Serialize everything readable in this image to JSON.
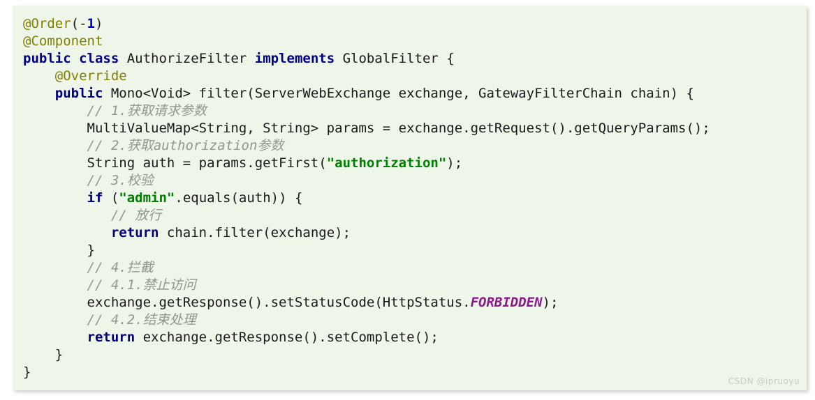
{
  "theme": {
    "page_background": "#ffffff",
    "code_background": "#eef5e9",
    "plain_color": "#1a1a1a",
    "annotation_color": "#808000",
    "keyword_color": "#000080",
    "string_color": "#008000",
    "number_color": "#0000c0",
    "comment_color": "#8f978f",
    "constant_color": "#8b1a8b"
  },
  "watermark": {
    "text": "CSDN @lpruoyu"
  },
  "code": {
    "language": "java",
    "lines": [
      {
        "indent": "",
        "tokens": [
          {
            "type": "annotation",
            "text": "@Order"
          },
          {
            "type": "plain",
            "text": "(-"
          },
          {
            "type": "number",
            "text": "1"
          },
          {
            "type": "plain",
            "text": ")"
          }
        ]
      },
      {
        "indent": "",
        "tokens": [
          {
            "type": "annotation",
            "text": "@Component"
          }
        ]
      },
      {
        "indent": "",
        "tokens": [
          {
            "type": "keyword",
            "text": "public class"
          },
          {
            "type": "plain",
            "text": " AuthorizeFilter "
          },
          {
            "type": "keyword",
            "text": "implements"
          },
          {
            "type": "plain",
            "text": " GlobalFilter {"
          }
        ]
      },
      {
        "indent": "    ",
        "tokens": [
          {
            "type": "annotation",
            "text": "@Override"
          }
        ]
      },
      {
        "indent": "    ",
        "tokens": [
          {
            "type": "keyword",
            "text": "public"
          },
          {
            "type": "plain",
            "text": " Mono<Void> filter(ServerWebExchange exchange, GatewayFilterChain chain) {"
          }
        ]
      },
      {
        "indent": "        ",
        "tokens": [
          {
            "type": "comment",
            "text": "// 1.获取请求参数"
          }
        ]
      },
      {
        "indent": "        ",
        "tokens": [
          {
            "type": "plain",
            "text": "MultiValueMap<String, String> params = exchange.getRequest().getQueryParams();"
          }
        ]
      },
      {
        "indent": "        ",
        "tokens": [
          {
            "type": "comment",
            "text": "// 2.获取authorization参数"
          }
        ]
      },
      {
        "indent": "        ",
        "tokens": [
          {
            "type": "plain",
            "text": "String auth = params.getFirst("
          },
          {
            "type": "string",
            "text": "\"authorization\""
          },
          {
            "type": "plain",
            "text": ");"
          }
        ]
      },
      {
        "indent": "        ",
        "tokens": [
          {
            "type": "comment",
            "text": "// 3.校验"
          }
        ]
      },
      {
        "indent": "        ",
        "tokens": [
          {
            "type": "keyword",
            "text": "if"
          },
          {
            "type": "plain",
            "text": " ("
          },
          {
            "type": "string",
            "text": "\"admin\""
          },
          {
            "type": "plain",
            "text": ".equals(auth)) {"
          }
        ]
      },
      {
        "indent": "           ",
        "tokens": [
          {
            "type": "comment",
            "text": "// 放行"
          }
        ]
      },
      {
        "indent": "           ",
        "tokens": [
          {
            "type": "keyword",
            "text": "return"
          },
          {
            "type": "plain",
            "text": " chain.filter(exchange);"
          }
        ]
      },
      {
        "indent": "        ",
        "tokens": [
          {
            "type": "plain",
            "text": "}"
          }
        ]
      },
      {
        "indent": "        ",
        "tokens": [
          {
            "type": "comment",
            "text": "// 4.拦截"
          }
        ]
      },
      {
        "indent": "        ",
        "tokens": [
          {
            "type": "comment",
            "text": "// 4.1.禁止访问"
          }
        ]
      },
      {
        "indent": "        ",
        "tokens": [
          {
            "type": "plain",
            "text": "exchange.getResponse().setStatusCode(HttpStatus."
          },
          {
            "type": "constant",
            "text": "FORBIDDEN"
          },
          {
            "type": "plain",
            "text": ");"
          }
        ]
      },
      {
        "indent": "        ",
        "tokens": [
          {
            "type": "comment",
            "text": "// 4.2.结束处理"
          }
        ]
      },
      {
        "indent": "        ",
        "tokens": [
          {
            "type": "keyword",
            "text": "return"
          },
          {
            "type": "plain",
            "text": " exchange.getResponse().setComplete();"
          }
        ]
      },
      {
        "indent": "    ",
        "tokens": [
          {
            "type": "plain",
            "text": "}"
          }
        ]
      },
      {
        "indent": "",
        "tokens": [
          {
            "type": "plain",
            "text": "}"
          }
        ]
      }
    ]
  }
}
